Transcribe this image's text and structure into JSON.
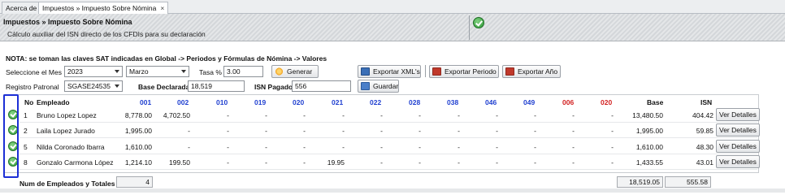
{
  "tabs": [
    {
      "label": "Acerca de",
      "active": false
    },
    {
      "label": "Impuestos » Impuesto Sobre Nómina",
      "active": true
    }
  ],
  "header": {
    "title": "Impuestos » Impuesto Sobre Nómina",
    "subtitle": "Cálculo auxiliar del ISN directo de los CFDIs para su declaración"
  },
  "note": "NOTA: se toman las claves SAT indicadas en Global -> Periodos y Fórmulas de Nómina -> Valores",
  "filters": {
    "mes_label": "Seleccione el Mes",
    "year_value": "2023",
    "month_value": "Marzo",
    "tasa_label": "Tasa %",
    "tasa_value": "3.00",
    "registro_label": "Registro Patronal",
    "registro_value": "SGASE24535",
    "base_label": "Base Declarada",
    "base_value": "18,519",
    "isn_label": "ISN Pagado",
    "isn_value": "556"
  },
  "buttons": {
    "generar": "Generar",
    "exportar_xml": "Exportar XML's",
    "exportar_periodo": "Exportar Periodo",
    "exportar_anio": "Exportar Año",
    "guardar": "Guardar",
    "ver_detalles": "Ver Detalles"
  },
  "colors": {
    "blue_header": "#1f3fd0",
    "red_header": "#d21f1f",
    "highlight": "#1c2fd6",
    "ok_green": "#36a03e"
  },
  "table": {
    "columns": [
      "No",
      "Empleado",
      "001",
      "002",
      "010",
      "019",
      "020",
      "021",
      "022",
      "028",
      "038",
      "046",
      "049",
      "006",
      "020",
      "Base",
      "ISN"
    ],
    "rows": [
      {
        "no": "1",
        "empleado": "Bruno Lopez Lopez",
        "c001": "8,778.00",
        "c002": "4,702.50",
        "c010": "-",
        "c019": "-",
        "c020": "-",
        "c021": "-",
        "c022": "-",
        "c028": "-",
        "c038": "-",
        "c046": "-",
        "c049": "-",
        "c006": "-",
        "c020b": "-",
        "base": "13,480.50",
        "isn": "404.42"
      },
      {
        "no": "2",
        "empleado": "Laila Lopez Jurado",
        "c001": "1,995.00",
        "c002": "-",
        "c010": "-",
        "c019": "-",
        "c020": "-",
        "c021": "-",
        "c022": "-",
        "c028": "-",
        "c038": "-",
        "c046": "-",
        "c049": "-",
        "c006": "-",
        "c020b": "-",
        "base": "1,995.00",
        "isn": "59.85"
      },
      {
        "no": "5",
        "empleado": "Nilda Coronado Ibarra",
        "c001": "1,610.00",
        "c002": "-",
        "c010": "-",
        "c019": "-",
        "c020": "-",
        "c021": "-",
        "c022": "-",
        "c028": "-",
        "c038": "-",
        "c046": "-",
        "c049": "-",
        "c006": "-",
        "c020b": "-",
        "base": "1,610.00",
        "isn": "48.30"
      },
      {
        "no": "8",
        "empleado": "Gonzalo Carmona López",
        "c001": "1,214.10",
        "c002": "199.50",
        "c010": "-",
        "c019": "-",
        "c020": "-",
        "c021": "19.95",
        "c022": "-",
        "c028": "-",
        "c038": "-",
        "c046": "-",
        "c049": "-",
        "c006": "-",
        "c020b": "-",
        "base": "1,433.55",
        "isn": "43.01"
      }
    ]
  },
  "totals": {
    "label": "Num de Empleados y Totales",
    "count": "4",
    "base": "18,519.05",
    "isn": "555.58"
  }
}
